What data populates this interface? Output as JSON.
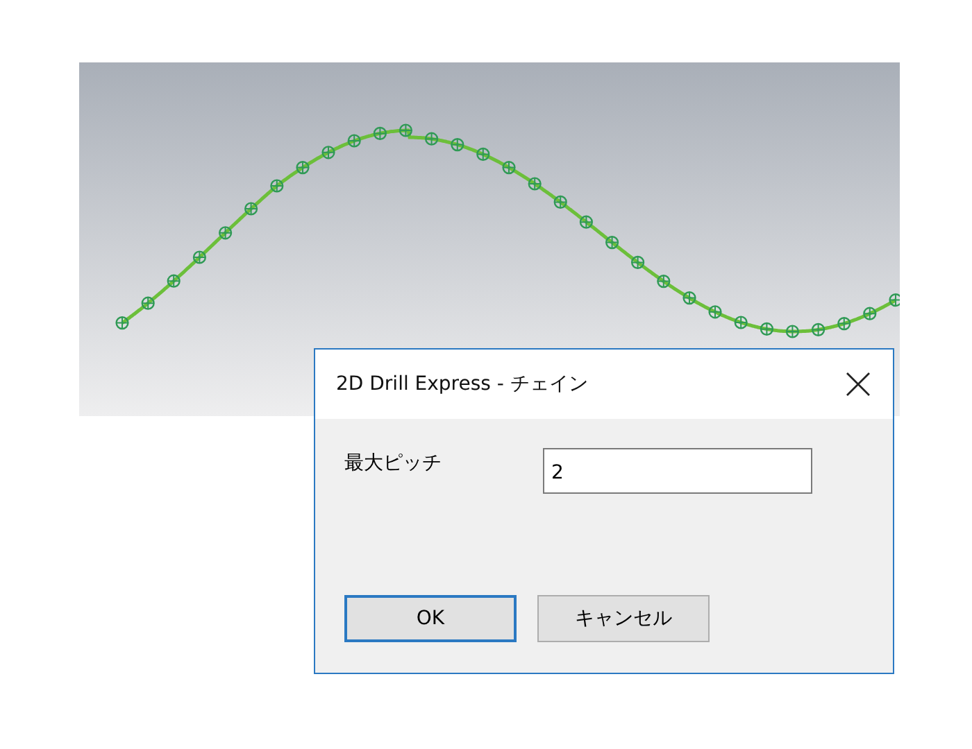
{
  "dialog": {
    "title": "2D Drill Express - チェイン",
    "fields": [
      {
        "label": "最大ピッチ",
        "value": "2"
      }
    ],
    "buttons": [
      {
        "label": "OK",
        "default": true
      },
      {
        "label": "キャンセル",
        "default": false
      }
    ]
  }
}
